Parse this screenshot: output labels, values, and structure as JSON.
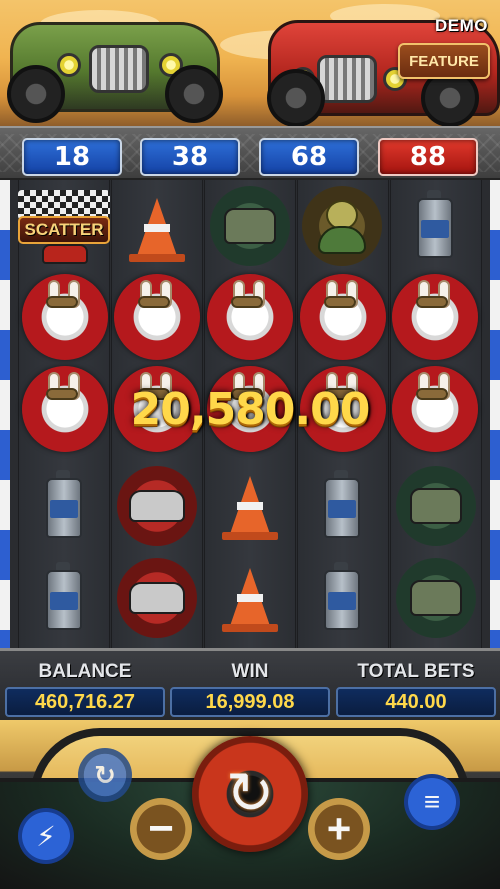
{
  "header": {
    "demo_label": "DEMO",
    "feature_label": "FEATURE"
  },
  "lines": [
    {
      "label": "18",
      "style": "blue"
    },
    {
      "label": "38",
      "style": "blue"
    },
    {
      "label": "68",
      "style": "blue"
    },
    {
      "label": "88",
      "style": "red"
    }
  ],
  "reels": [
    [
      "scatter",
      "rabbit",
      "rabbit",
      "oil-can",
      "oil-can"
    ],
    [
      "traffic-cone",
      "rabbit",
      "rabbit",
      "red-car",
      "red-car"
    ],
    [
      "green-car",
      "rabbit",
      "rabbit",
      "traffic-cone",
      "traffic-cone"
    ],
    [
      "turtle",
      "rabbit",
      "rabbit",
      "oil-can",
      "oil-can"
    ],
    [
      "oil-can",
      "rabbit",
      "rabbit",
      "green-car",
      "green-car"
    ]
  ],
  "scatter_text": "SCATTER",
  "win_amount": "20,580.00",
  "info": {
    "balance_label": "BALANCE",
    "balance_value": "460,716.27",
    "win_label": "WIN",
    "win_value": "16,999.08",
    "total_bets_label": "TOTAL BETS",
    "total_bets_value": "440.00"
  },
  "controls": {
    "spin_icon": "refresh-arrows-icon",
    "minus_icon": "minus-icon",
    "plus_icon": "plus-icon",
    "autoplay_icon": "autoplay-icon",
    "turbo_icon": "lightning-icon",
    "menu_icon": "menu-icon"
  },
  "colors": {
    "win_gold": "#ffd84a",
    "line_blue": "#1f5cc8",
    "line_red": "#c41f17",
    "value_panel": "#0f2c5e"
  }
}
